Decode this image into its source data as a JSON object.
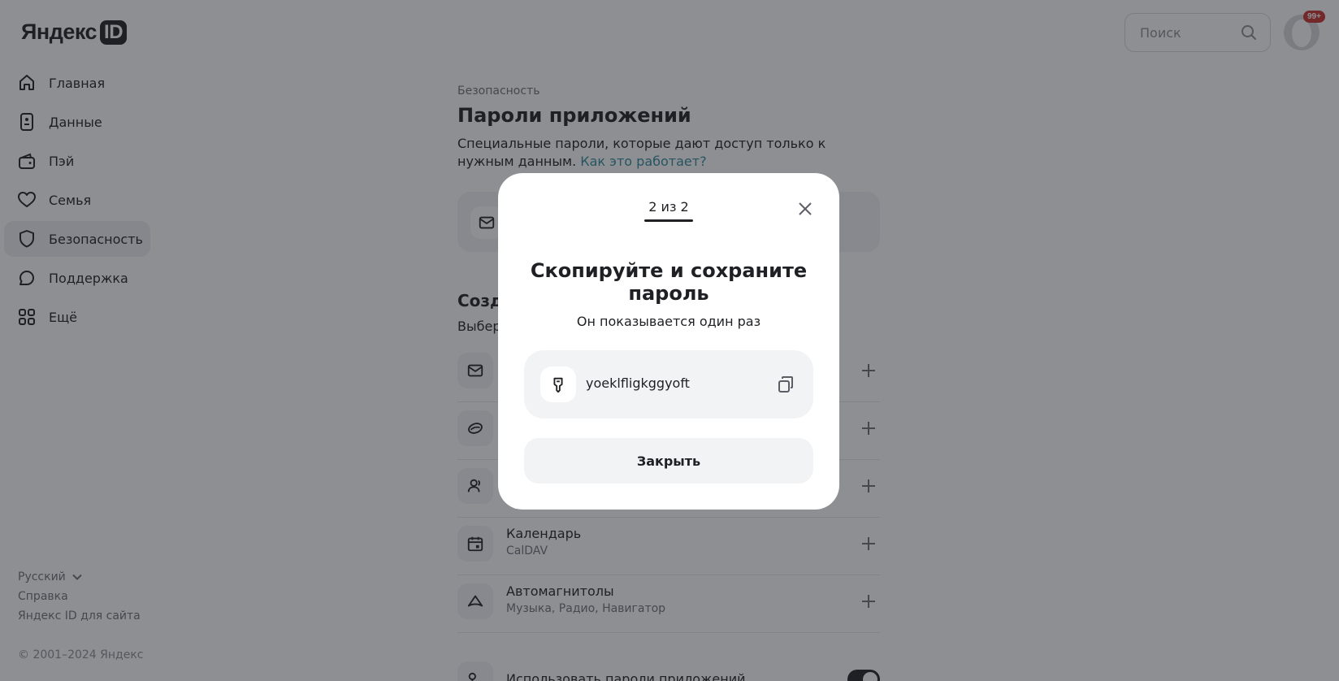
{
  "header": {
    "logo_text": "Яндекс",
    "logo_id": "ID",
    "search_placeholder": "Поиск",
    "notification_badge": "99+"
  },
  "sidebar": {
    "items": [
      {
        "label": "Главная",
        "icon": "home-icon"
      },
      {
        "label": "Данные",
        "icon": "id-card-icon"
      },
      {
        "label": "Пэй",
        "icon": "wallet-icon"
      },
      {
        "label": "Семья",
        "icon": "heart-icon"
      },
      {
        "label": "Безопасность",
        "icon": "shield-icon",
        "active": true
      },
      {
        "label": "Поддержка",
        "icon": "chat-icon"
      },
      {
        "label": "Ещё",
        "icon": "grid-icon"
      }
    ],
    "footer": {
      "language": "Русский",
      "help": "Справка",
      "for_site": "Яндекс ID для сайта",
      "copyright": "© 2001–2024 Яндекс"
    }
  },
  "main": {
    "breadcrumb": "Безопасность",
    "title": "Пароли приложений",
    "description": "Специальные пароли, которые дают доступ только к нужным данным.",
    "description_link": "Как это работает?",
    "create_title": "Созда",
    "create_subtitle": "Выбер",
    "rows": [
      {
        "title": "",
        "subtitle": "",
        "icon": "mail-icon"
      },
      {
        "title": "",
        "subtitle": "",
        "icon": "disk-icon"
      },
      {
        "title": "",
        "subtitle": "",
        "icon": "contacts-icon"
      },
      {
        "title": "Календарь",
        "subtitle": "CalDAV",
        "icon": "calendar-icon"
      },
      {
        "title": "Автомагнитолы",
        "subtitle": "Музыка, Радио, Навигатор",
        "icon": "car-icon"
      }
    ],
    "use_passwords_label": "Использовать пароли приложений"
  },
  "modal": {
    "step": "2 из 2",
    "title": "Скопируйте и сохраните пароль",
    "subtitle": "Он показывается один раз",
    "password": "yoeklfligkggyoft",
    "close_button": "Закрыть"
  },
  "colors": {
    "text": "#1f2024",
    "link": "#2f8a9a",
    "badge": "#c9302c",
    "surface": "#f2f3f5"
  }
}
